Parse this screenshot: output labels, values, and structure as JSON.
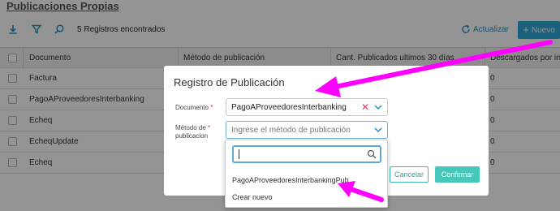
{
  "page": {
    "title": "Publicaciones Propias"
  },
  "toolbar": {
    "download_icon": "download-icon",
    "filter_icon": "filter-icon",
    "search_icon": "search-icon",
    "records_count": "5",
    "records_label": "Registros encontrados",
    "refresh_label": "Actualizar",
    "new_label": "Nuevo"
  },
  "table": {
    "headers": [
      "Documento",
      "Método de publicación",
      "Cant. Publicados ultimos 30 días",
      "Descargados por int"
    ],
    "rows": [
      {
        "documento": "Factura",
        "descargados": "0"
      },
      {
        "documento": "PagoAProveedoresInterbanking",
        "descargados": "0"
      },
      {
        "documento": "Echeq",
        "descargados": "0"
      },
      {
        "documento": "EcheqUpdate",
        "descargados": "0"
      },
      {
        "documento": "Echeq",
        "descargados": "0"
      }
    ]
  },
  "modal": {
    "title": "Registro de Publicación",
    "documento_label": "Documento",
    "documento_value": "PagoAProveedoresInterbanking",
    "metodo_label_1": "Método de",
    "metodo_label_2": "publicacion",
    "metodo_placeholder": "Ingrese el método de publicación",
    "required_mark": "*",
    "cancel_label": "Cancelar",
    "confirm_label": "Confirmar"
  },
  "dropdown": {
    "search_value": "",
    "options": [
      "PagoAProveedoresInterbankingPub",
      "Crear nuevo"
    ]
  },
  "colors": {
    "primary": "#2ba6d6",
    "teal": "#45c7b9",
    "annotation": "#ff00ff"
  }
}
